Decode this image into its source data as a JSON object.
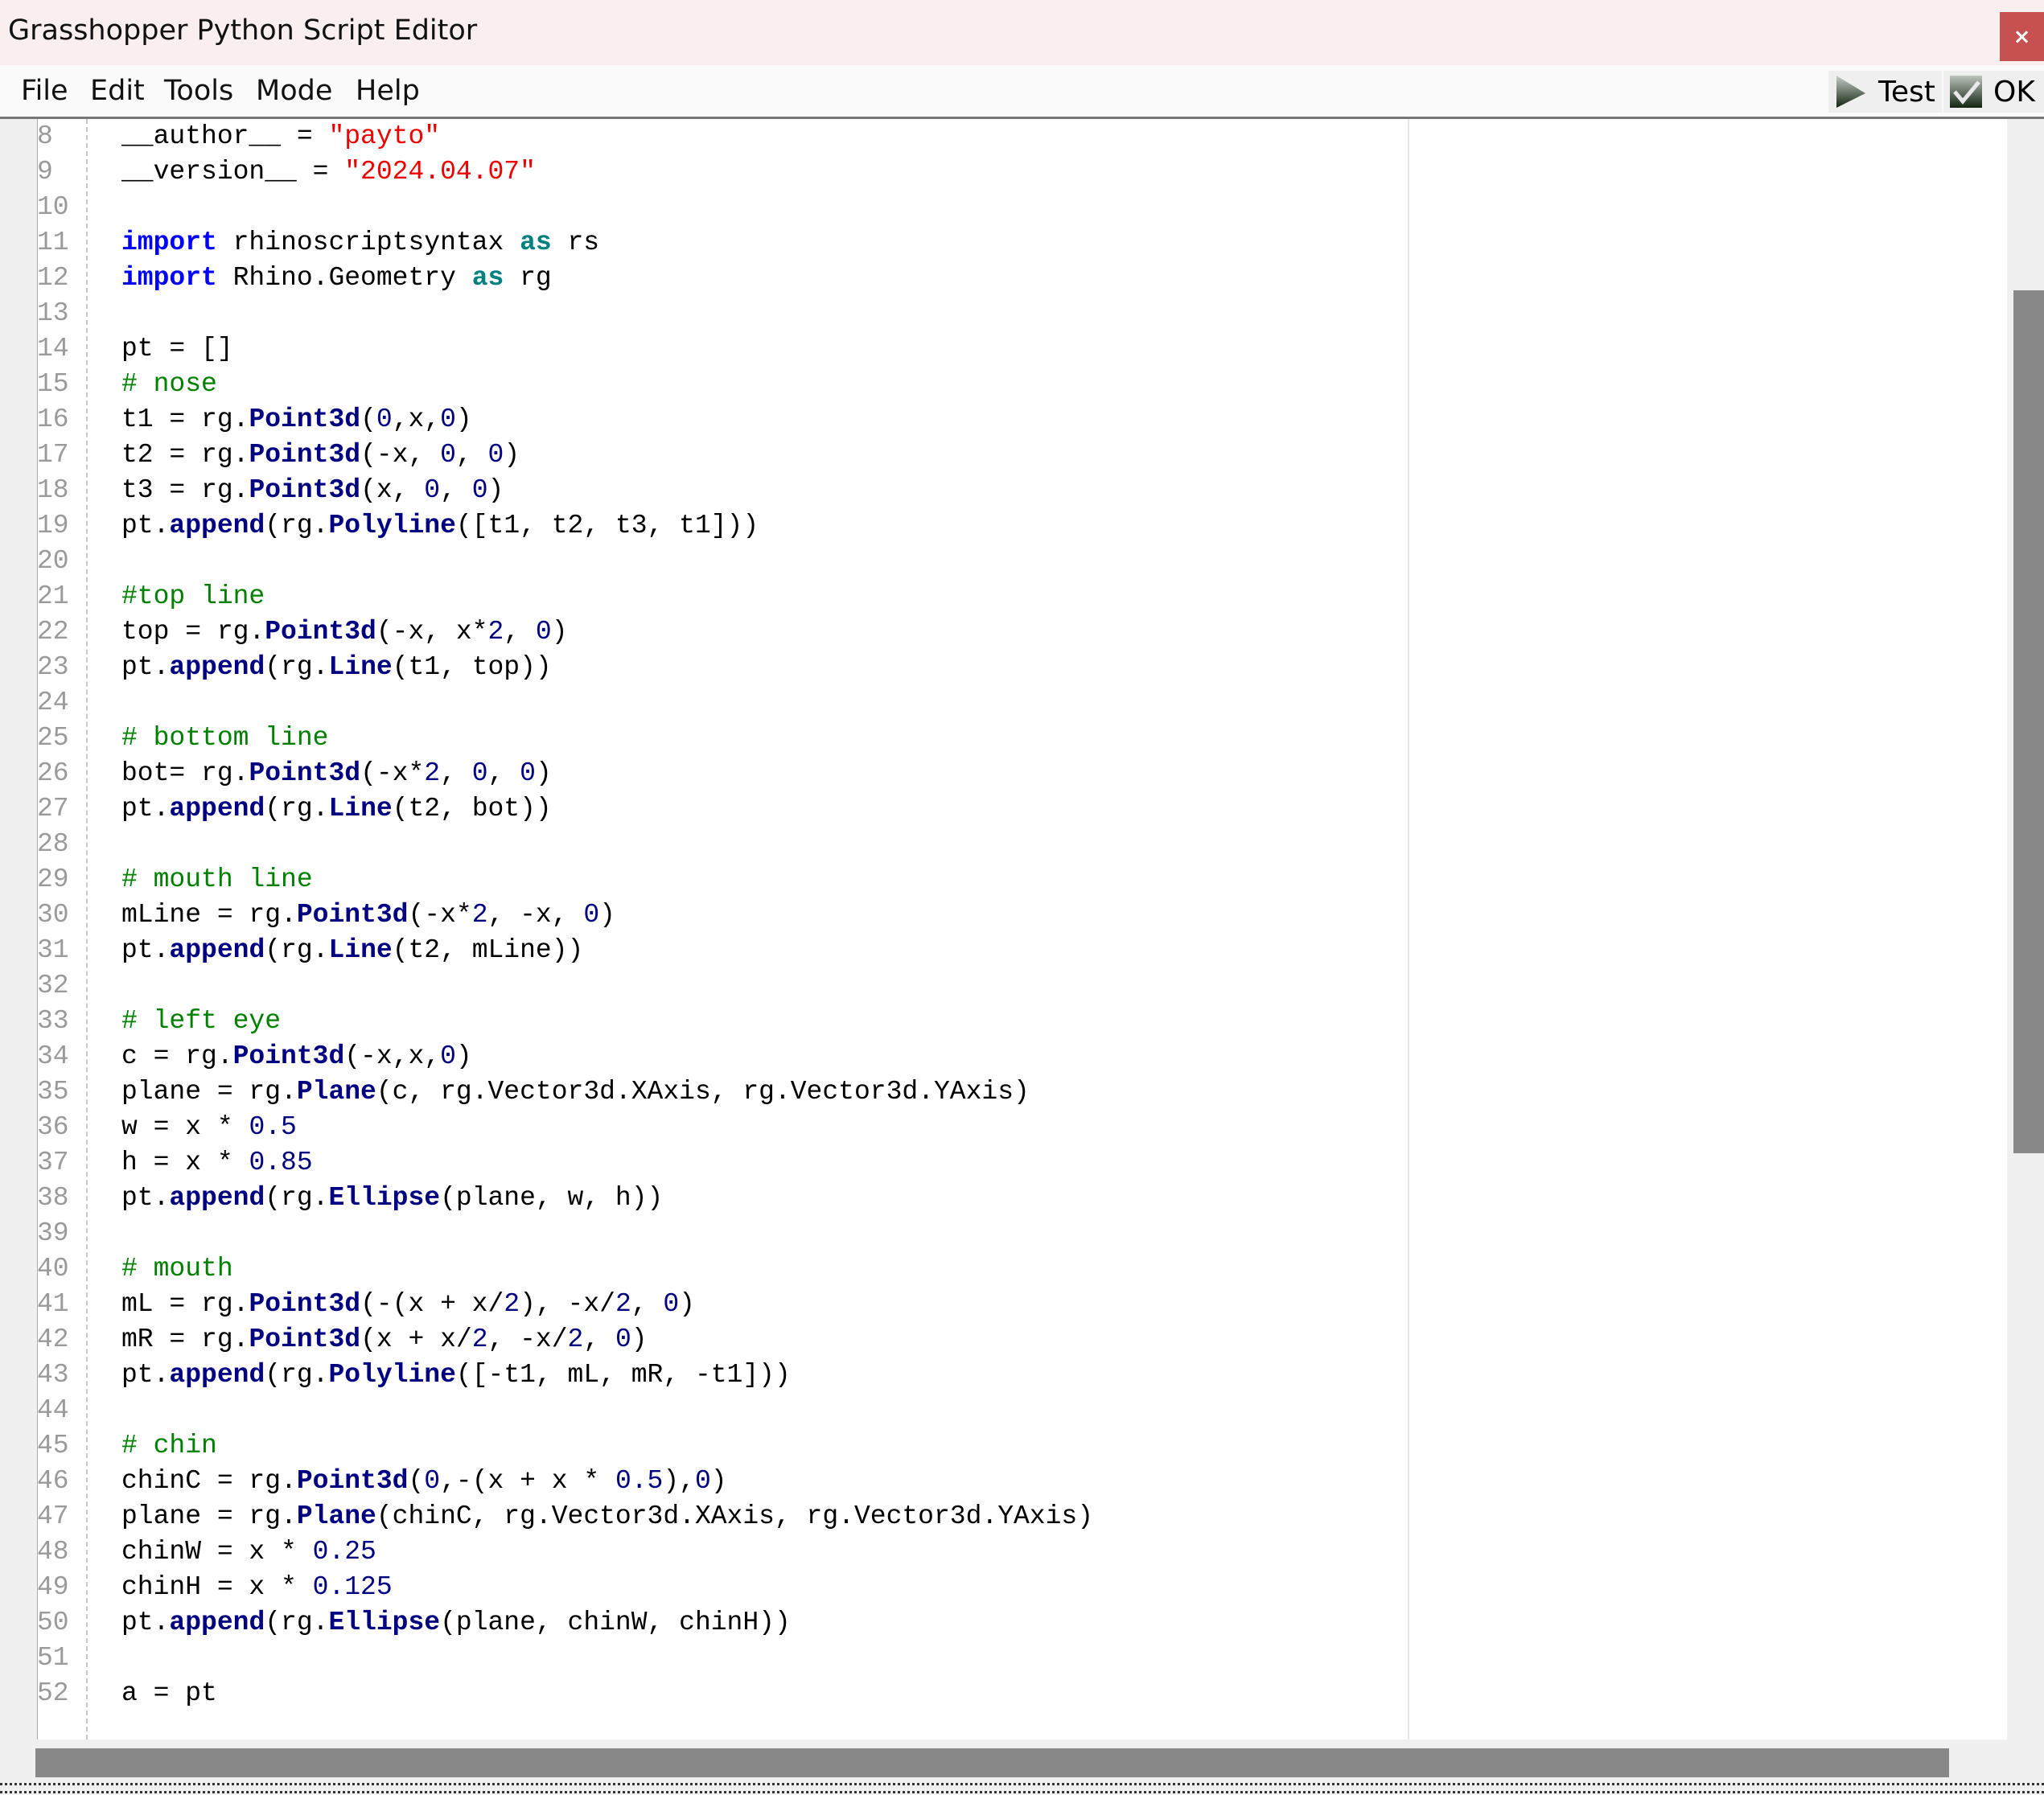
{
  "window": {
    "title": "Grasshopper Python Script Editor",
    "close_label": "×"
  },
  "menu": {
    "items": [
      "File",
      "Edit",
      "Tools",
      "Mode",
      "Help"
    ]
  },
  "toolbar": {
    "test_label": "Test",
    "ok_label": "OK",
    "test_icon": "play-icon",
    "ok_icon": "checkmark-icon"
  },
  "theme": {
    "keyword": "#0000ff",
    "keyword_as": "#008080",
    "string": "#ee0000",
    "comment": "#008000",
    "method": "#000080",
    "number": "#000080",
    "close_bg": "#c75050"
  },
  "editor": {
    "lines": [
      {
        "n": "8",
        "code": "__author__ = \"payto\""
      },
      {
        "n": "9",
        "code": "__version__ = \"2024.04.07\""
      },
      {
        "n": "10",
        "code": ""
      },
      {
        "n": "11",
        "code": "import rhinoscriptsyntax as rs"
      },
      {
        "n": "12",
        "code": "import Rhino.Geometry as rg"
      },
      {
        "n": "13",
        "code": ""
      },
      {
        "n": "14",
        "code": "pt = []"
      },
      {
        "n": "15",
        "code": "# nose"
      },
      {
        "n": "16",
        "code": "t1 = rg.Point3d(0,x,0)"
      },
      {
        "n": "17",
        "code": "t2 = rg.Point3d(-x, 0, 0)"
      },
      {
        "n": "18",
        "code": "t3 = rg.Point3d(x, 0, 0)"
      },
      {
        "n": "19",
        "code": "pt.append(rg.Polyline([t1, t2, t3, t1]))"
      },
      {
        "n": "20",
        "code": ""
      },
      {
        "n": "21",
        "code": "#top line"
      },
      {
        "n": "22",
        "code": "top = rg.Point3d(-x, x*2, 0)"
      },
      {
        "n": "23",
        "code": "pt.append(rg.Line(t1, top))"
      },
      {
        "n": "24",
        "code": ""
      },
      {
        "n": "25",
        "code": "# bottom line"
      },
      {
        "n": "26",
        "code": "bot= rg.Point3d(-x*2, 0, 0)"
      },
      {
        "n": "27",
        "code": "pt.append(rg.Line(t2, bot))"
      },
      {
        "n": "28",
        "code": ""
      },
      {
        "n": "29",
        "code": "# mouth line"
      },
      {
        "n": "30",
        "code": "mLine = rg.Point3d(-x*2, -x, 0)"
      },
      {
        "n": "31",
        "code": "pt.append(rg.Line(t2, mLine))"
      },
      {
        "n": "32",
        "code": ""
      },
      {
        "n": "33",
        "code": "# left eye"
      },
      {
        "n": "34",
        "code": "c = rg.Point3d(-x,x,0)"
      },
      {
        "n": "35",
        "code": "plane = rg.Plane(c, rg.Vector3d.XAxis, rg.Vector3d.YAxis)"
      },
      {
        "n": "36",
        "code": "w = x * 0.5"
      },
      {
        "n": "37",
        "code": "h = x * 0.85"
      },
      {
        "n": "38",
        "code": "pt.append(rg.Ellipse(plane, w, h))"
      },
      {
        "n": "39",
        "code": ""
      },
      {
        "n": "40",
        "code": "# mouth"
      },
      {
        "n": "41",
        "code": "mL = rg.Point3d(-(x + x/2), -x/2, 0)"
      },
      {
        "n": "42",
        "code": "mR = rg.Point3d(x + x/2, -x/2, 0)"
      },
      {
        "n": "43",
        "code": "pt.append(rg.Polyline([-t1, mL, mR, -t1]))"
      },
      {
        "n": "44",
        "code": ""
      },
      {
        "n": "45",
        "code": "# chin"
      },
      {
        "n": "46",
        "code": "chinC = rg.Point3d(0,-(x + x * 0.5),0)"
      },
      {
        "n": "47",
        "code": "plane = rg.Plane(chinC, rg.Vector3d.XAxis, rg.Vector3d.YAxis)"
      },
      {
        "n": "48",
        "code": "chinW = x * 0.25"
      },
      {
        "n": "49",
        "code": "chinH = x * 0.125"
      },
      {
        "n": "50",
        "code": "pt.append(rg.Ellipse(plane, chinW, chinH))"
      },
      {
        "n": "51",
        "code": ""
      },
      {
        "n": "52",
        "code": "a = pt"
      }
    ]
  }
}
